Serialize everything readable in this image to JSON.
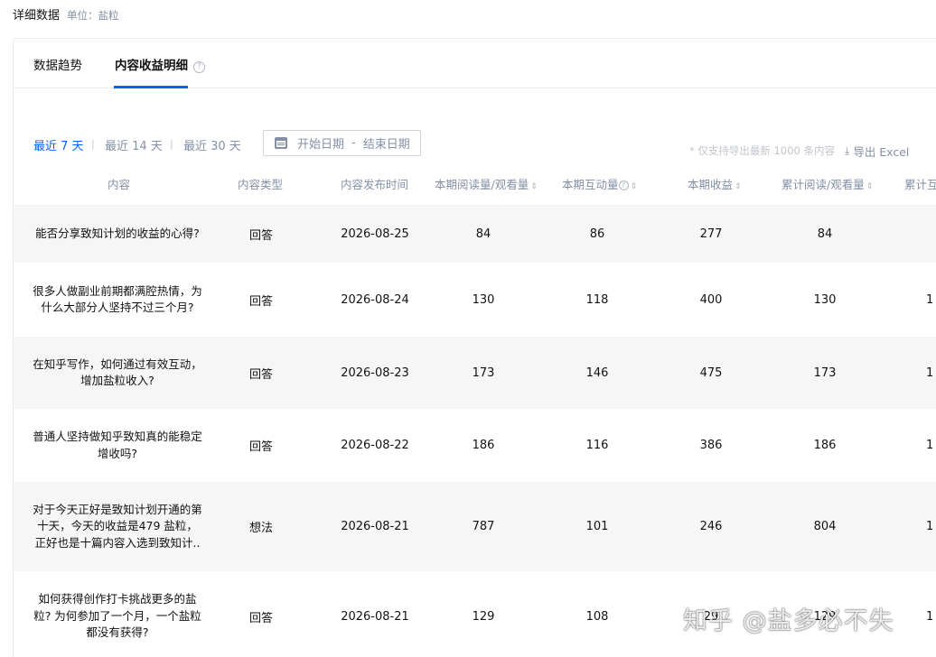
{
  "header": {
    "title": "详细数据",
    "unit": "单位：盐粒"
  },
  "tabs": [
    {
      "label": "数据趋势"
    },
    {
      "label": "内容收益明细"
    }
  ],
  "tab_help_glyph": "?",
  "ranges": [
    {
      "label": "最近 7 天",
      "active": true
    },
    {
      "label": "最近 14 天",
      "active": false
    },
    {
      "label": "最近 30 天",
      "active": false
    }
  ],
  "range_separator": "|",
  "date_picker": {
    "start_placeholder": "开始日期",
    "dash": "-",
    "end_placeholder": "结束日期",
    "icon": "calendar-icon"
  },
  "export": {
    "note": "* 仅支持导出最新 1000 条内容",
    "label": "导出 Excel",
    "icon": "download-icon",
    "icon_glyph": "⤓"
  },
  "columns": [
    {
      "label": "内容",
      "sortable": false
    },
    {
      "label": "内容类型",
      "sortable": false
    },
    {
      "label": "内容发布时间",
      "sortable": false
    },
    {
      "label": "本期阅读量/观看量",
      "sortable": true
    },
    {
      "label": "本期互动量",
      "sortable": true,
      "help": true
    },
    {
      "label": "本期收益",
      "sortable": true
    },
    {
      "label": "累计阅读/观看量",
      "sortable": true
    },
    {
      "label": "累计互",
      "sortable": false
    }
  ],
  "sort_glyph": "⇕",
  "rows": [
    {
      "title_lines": [
        "能否分享致知计划的收益的心得?"
      ],
      "type": "回答",
      "date": "2026-08-25",
      "reads": "84",
      "interactions": "86",
      "earnings": "277",
      "total_reads": "84",
      "overflow": ""
    },
    {
      "title_lines": [
        "很多人做副业前期都满腔热情，为",
        "什么大部分人坚持不过三个月?"
      ],
      "type": "回答",
      "date": "2026-08-24",
      "reads": "130",
      "interactions": "118",
      "earnings": "400",
      "total_reads": "130",
      "overflow": "1"
    },
    {
      "title_lines": [
        "在知乎写作，如何通过有效互动，",
        "增加盐粒收入?"
      ],
      "type": "回答",
      "date": "2026-08-23",
      "reads": "173",
      "interactions": "146",
      "earnings": "475",
      "total_reads": "173",
      "overflow": "1"
    },
    {
      "title_lines": [
        "普通人坚持做知乎致知真的能稳定",
        "增收吗?"
      ],
      "type": "回答",
      "date": "2026-08-22",
      "reads": "186",
      "interactions": "116",
      "earnings": "386",
      "total_reads": "186",
      "overflow": "1"
    },
    {
      "title_lines": [
        "对于今天正好是致知计划开通的第",
        "十天，今天的收益是479 盐粒，",
        "正好也是十篇内容入选到致知计.."
      ],
      "type": "想法",
      "date": "2026-08-21",
      "reads": "787",
      "interactions": "101",
      "earnings": "246",
      "total_reads": "804",
      "overflow": "1"
    },
    {
      "title_lines": [
        "如何获得创作打卡挑战更多的盐",
        "粒? 为何参加了一个月，一个盐粒",
        "都没有获得?"
      ],
      "type": "回答",
      "date": "2026-08-21",
      "reads": "129",
      "interactions": "108",
      "earnings": "29",
      "total_reads": "129",
      "overflow": "1"
    }
  ],
  "watermark": "知乎 @盐多必不失",
  "colors": {
    "accent": "#0066ff",
    "muted": "#8590a6",
    "stripe": "#f6f6f6"
  }
}
